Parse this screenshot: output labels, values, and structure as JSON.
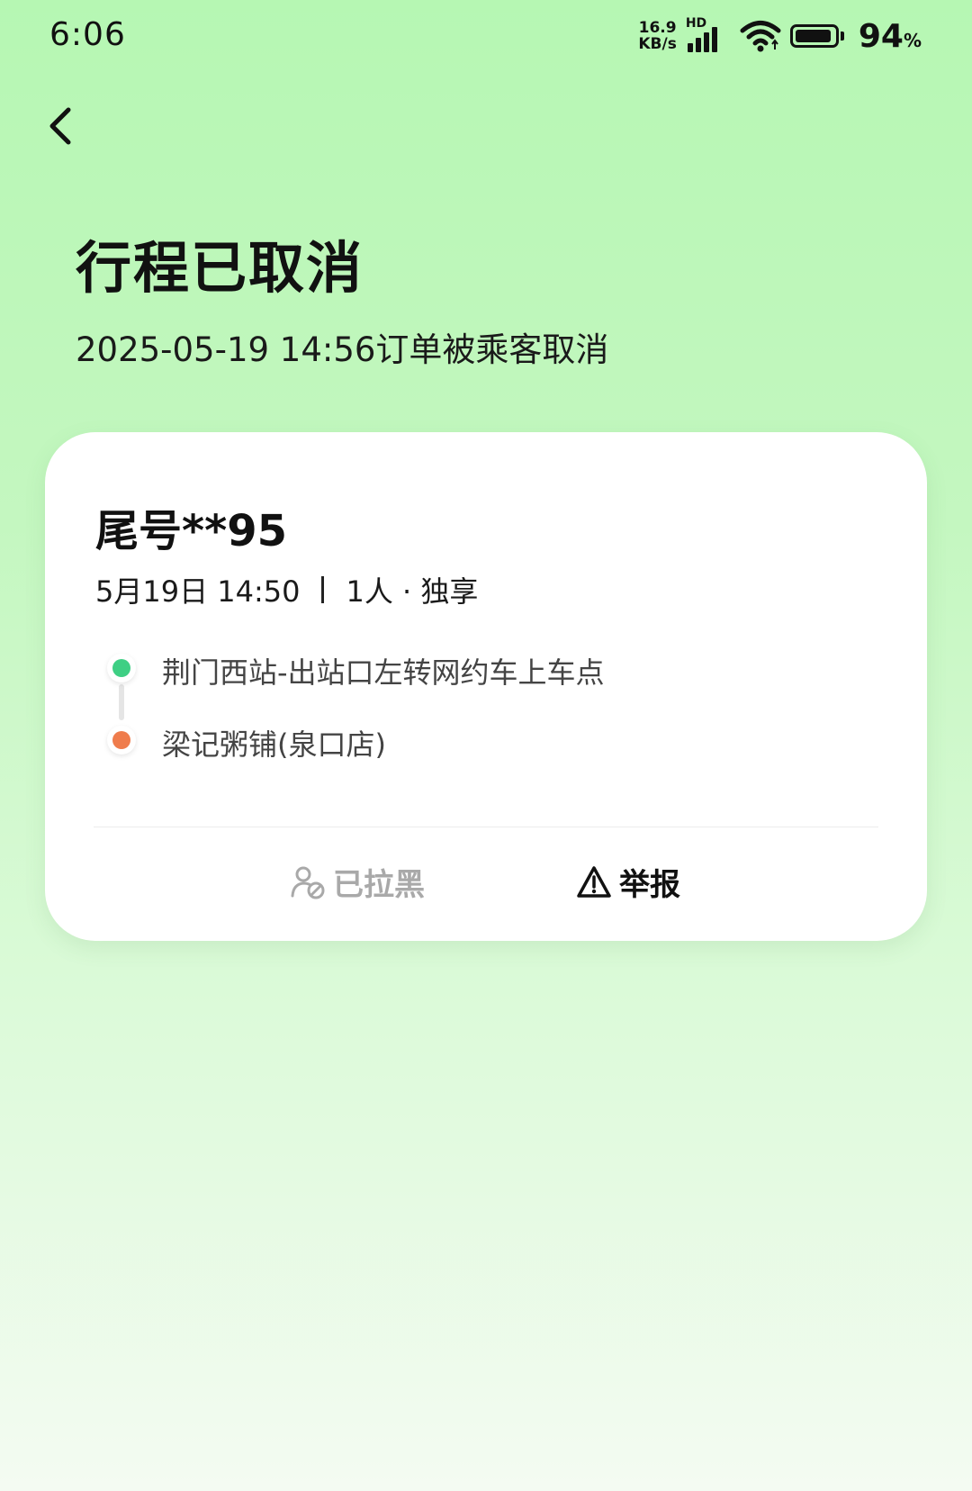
{
  "status_bar": {
    "time": "6:06",
    "net_speed_value": "16.9",
    "net_speed_unit": "KB/s",
    "hd_label": "HD",
    "battery_percent": "94",
    "battery_percent_sign": "%",
    "battery_level": 0.94
  },
  "header": {
    "title": "行程已取消",
    "subtitle": "2025-05-19 14:56订单被乘客取消"
  },
  "card": {
    "passenger_tail": "尾号**95",
    "trip_time": "5月19日 14:50",
    "trip_detail": "1人 · 独享",
    "route": {
      "start": "荆门西站-出站口左转网约车上车点",
      "end": "梁记粥铺(泉口店)"
    },
    "actions": {
      "blacklisted_label": "已拉黑",
      "report_label": "举报"
    }
  },
  "colors": {
    "start_dot": "#3ecf84",
    "end_dot": "#ef7c4c",
    "background_top": "#b6f7b3",
    "muted_text": "#a9a9a9"
  }
}
